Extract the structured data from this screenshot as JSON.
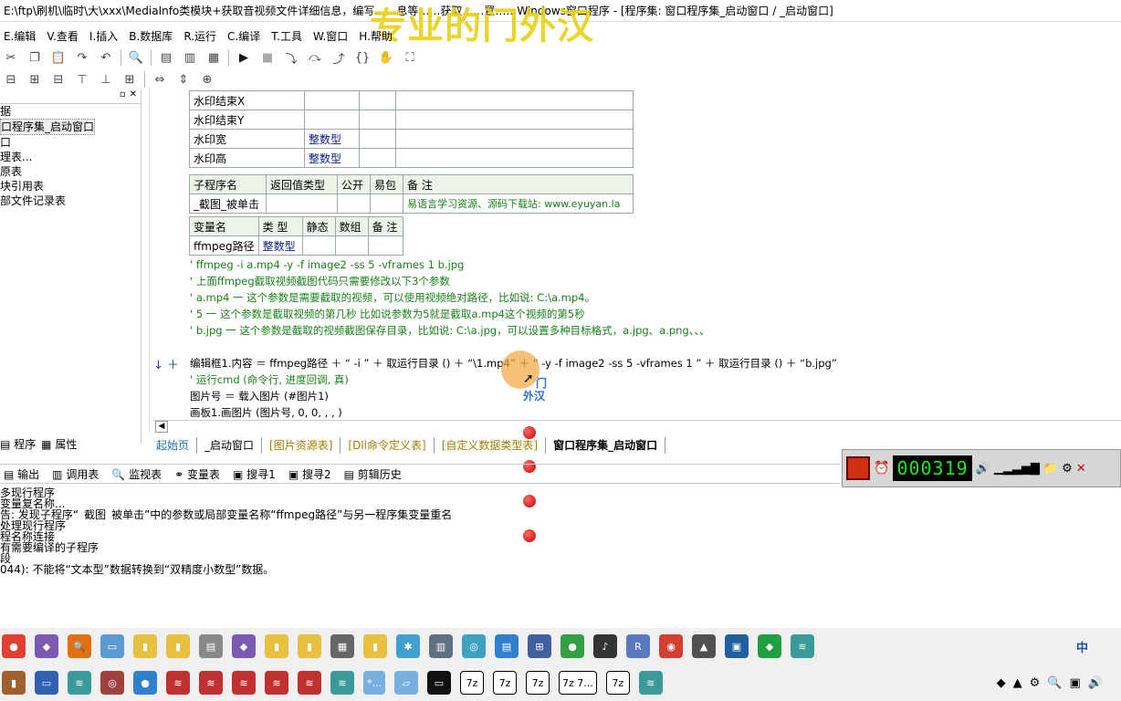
{
  "title": "E:\\ftp\\刷机\\临时\\大\\xxx\\MediaInfo类模块+获取音视频文件详细信息，编写……息等……获取……置……Windows窗口程序 - [程序集: 窗口程序集_启动窗口 / _启动窗口]",
  "watermark": "专业的门外汉",
  "menu": [
    "E.编辑",
    "V.查看",
    "I.插入",
    "B.数据库",
    "R.运行",
    "C.编译",
    "T.工具",
    "W.窗口",
    "H.帮助"
  ],
  "left_panel": {
    "items": [
      "据",
      "口程序集_启动窗口",
      "口",
      "理表...",
      "原表",
      "块引用表",
      "部文件记录表"
    ],
    "selected": "口程序集_启动窗口",
    "tabs": [
      "程序",
      "属性"
    ]
  },
  "table1": {
    "rows": [
      [
        "水印结束X",
        "",
        "",
        ""
      ],
      [
        "水印结束Y",
        "",
        "",
        ""
      ],
      [
        "水印宽",
        "整数型",
        "",
        ""
      ],
      [
        "水印高",
        "整数型",
        "",
        ""
      ]
    ]
  },
  "table2": {
    "headers": [
      "子程序名",
      "返回值类型",
      "公开",
      "易包",
      "备 注"
    ],
    "row": [
      "_截图_被单击",
      "",
      "",
      "",
      "易语言学习资源、源码下载站: www.eyuyan.la"
    ]
  },
  "table3": {
    "headers": [
      "变量名",
      "类 型",
      "静态",
      "数组",
      "备 注"
    ],
    "row": [
      "ffmpeg路径",
      "整数型",
      "",
      "",
      ""
    ]
  },
  "comments": [
    "' ffmpeg -i a.mp4 -y -f  image2  -ss 5 -vframes 1  b.jpg",
    "' 上面ffmpeg截取视频截图代码只需要修改以下3个参数",
    "' a.mp4 一 这个参数是需要截取的视频，可以使用视频绝对路径，比如说: C:\\a.mp4。",
    "' 5 一 这个参数是截取视频的第几秒  比如说参数为5就是截取a.mp4这个视频的第5秒",
    "' b.jpg 一 这个参数是截取的视频截图保存目录，比如说: C:\\a.jpg，可以设置多种目标格式，a.jpg、a.png、、、"
  ],
  "code_line": "编辑框1.内容 ＝ ffmpeg路径 ＋ “ -i ” ＋ 取运行目录 () ＋ “\\1.mp4” ＋ “ -y -f  image2  -ss 5 -vframes 1  ” ＋ 取运行目录 () ＋ “b.jpg”",
  "code_line2": "' 运行cmd (命令行, 进度回调, 真)",
  "code_line3": "图片号 ＝ 载入图片 (#图片1)",
  "code_line4": "画板1.画图片 (图片号, 0, 0, , , )",
  "cursor_tooltip": [
    "门",
    "外汉"
  ],
  "file_tabs": [
    "起始页",
    "_启动窗口",
    "[图片资源表]",
    "[Dll命令定义表]",
    "[自定义数据类型表]",
    "窗口程序集_启动窗口"
  ],
  "bottom_tabs": [
    "输出",
    "调用表",
    "监视表",
    "变量表",
    "搜寻1",
    "搜寻2",
    "剪辑历史"
  ],
  "output_lines": [
    "多现行程序",
    "变量复名称...",
    "告: 发现子程序“_截图_被单击”中的参数或局部变量名称“ffmpeg路径”与另一程序集变量重名",
    "处理现行程序",
    "程名称连接",
    "有需要编译的子程序",
    "段",
    "044): 不能将“文本型”数据转换到“双精度小数型”数据。"
  ],
  "recorder": {
    "time": "000319",
    "color_time": "#1ce81c"
  },
  "taskbar_label_ime": "中",
  "taskbar_row2_texts": [
    "7z",
    "7z",
    "7z",
    "7z 7...",
    "7z",
    "*...",
    "..."
  ]
}
